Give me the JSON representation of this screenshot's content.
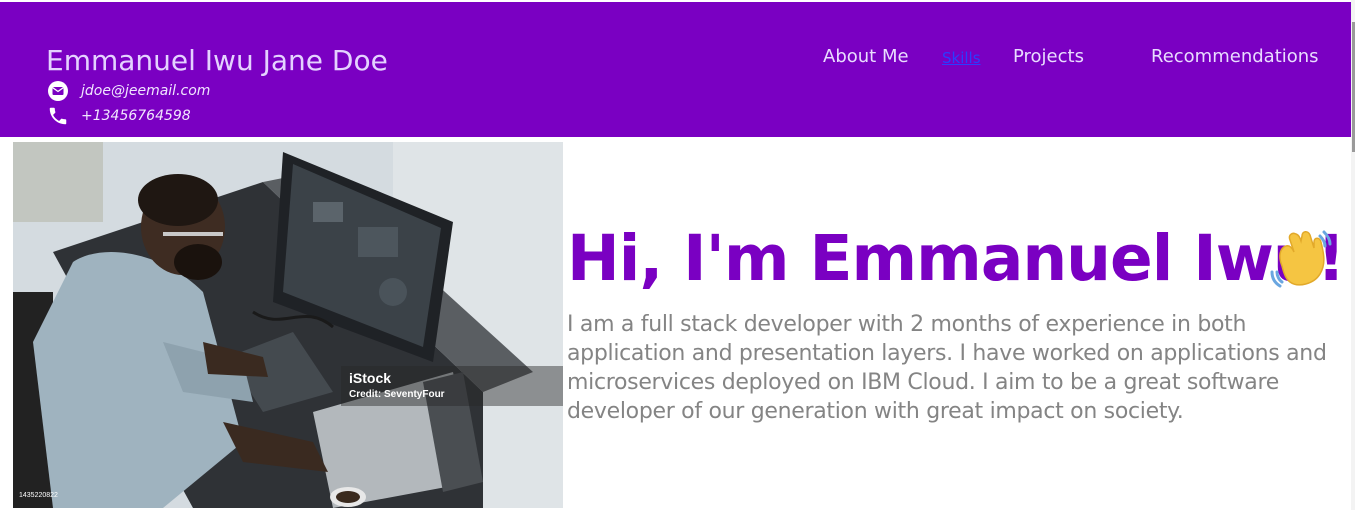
{
  "header": {
    "name": "Emmanuel Iwu Jane Doe",
    "email": "jdoe@jeemail.com",
    "phone": "+13456764598",
    "email_icon": "envelope-icon",
    "phone_icon": "phone-icon"
  },
  "nav": {
    "items": [
      {
        "label": "About Me",
        "active": false
      },
      {
        "label": "Skills",
        "active": true
      },
      {
        "label": "Projects",
        "active": false
      },
      {
        "label": "Recommendations",
        "active": false
      }
    ]
  },
  "hero": {
    "title": "Hi, I'm Emmanuel Iwu!",
    "wave_icon": "waving-hand-icon",
    "bio": "I am a full stack developer with 2 months of experience in both application and presentation layers. I have worked on applications and microservices deployed on IBM Cloud. I aim to be a great software developer of our generation with great impact on society.",
    "image": {
      "watermark_brand": "iStock",
      "watermark_credit": "Credit: SeventyFour",
      "image_id": "1435220822"
    }
  },
  "colors": {
    "header_bg": "#7a00c2",
    "title": "#7a00c2",
    "bio": "#848484",
    "active_link": "#2b3dff"
  }
}
